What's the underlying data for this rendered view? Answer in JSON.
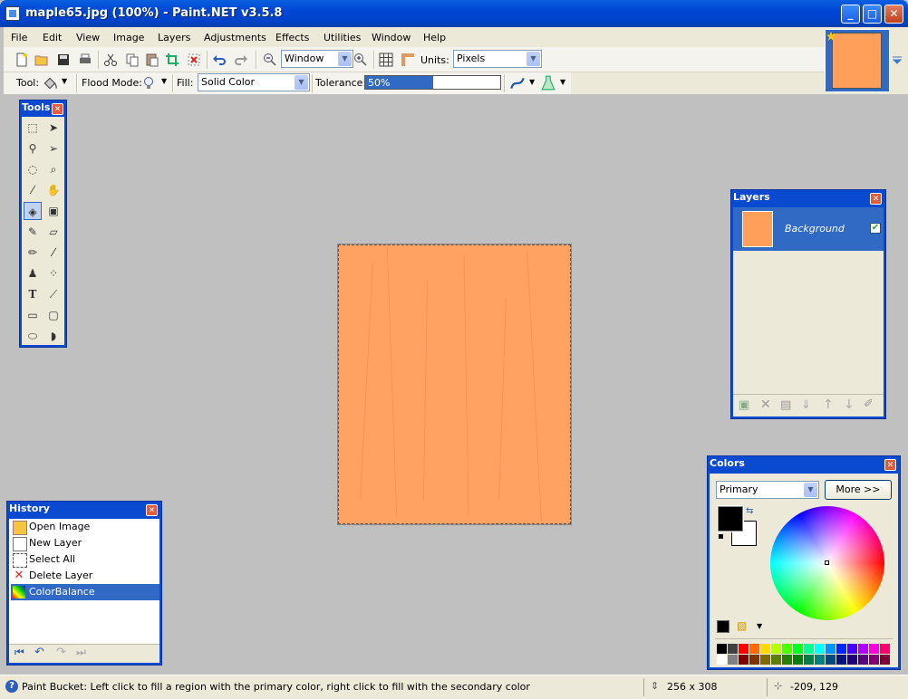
{
  "window": {
    "title": "maple65.jpg (100%) - Paint.NET v3.5.8",
    "minimize": "_",
    "maximize": "□",
    "close": "✕"
  },
  "menu": [
    "File",
    "Edit",
    "View",
    "Image",
    "Layers",
    "Adjustments",
    "Effects",
    "Utilities",
    "Window",
    "Help"
  ],
  "toolbar": {
    "zoom_value": "Window",
    "units_label": "Units:",
    "units_value": "Pixels"
  },
  "toolbar2": {
    "tool_label": "Tool:",
    "flood_mode_label": "Flood Mode:",
    "fill_label": "Fill:",
    "fill_value": "Solid Color",
    "tolerance_label": "Tolerance:",
    "tolerance_value": "50%",
    "tolerance_fraction": 0.5
  },
  "tools_window": {
    "title": "Tools",
    "close": "✕"
  },
  "layers_window": {
    "title": "Layers",
    "close": "✕",
    "layer_name": "Background",
    "layer_visible": true
  },
  "history_window": {
    "title": "History",
    "close": "✕",
    "items": [
      "Open Image",
      "New Layer",
      "Select All",
      "Delete Layer",
      "ColorBalance"
    ],
    "selected_index": 4
  },
  "colors_window": {
    "title": "Colors",
    "close": "✕",
    "mode_value": "Primary",
    "more_button": "More >>",
    "primary_color": "#000000",
    "secondary_color": "#ffffff"
  },
  "canvas": {
    "color": "#ffa262"
  },
  "status": {
    "hint": "Paint Bucket: Left click to fill a region with the primary color, right click to fill with the secondary color",
    "image_size": "256 x 308",
    "cursor_pos": "-209, 129"
  },
  "palette_top": [
    "#000000",
    "#404040",
    "#ff0000",
    "#ff6a00",
    "#ffd800",
    "#b6ff00",
    "#4cff00",
    "#00ff21",
    "#00ff90",
    "#00ffff",
    "#0094ff",
    "#0026ff",
    "#4800ff",
    "#b200ff",
    "#ff00dc",
    "#ff006e"
  ],
  "palette_bottom": [
    "#ffffff",
    "#808080",
    "#7f0000",
    "#7f3300",
    "#7f6a00",
    "#5b7f00",
    "#267f00",
    "#007f0e",
    "#007f46",
    "#007f7f",
    "#004a7f",
    "#00137f",
    "#21007f",
    "#57007f",
    "#7f006e",
    "#7f0037"
  ]
}
